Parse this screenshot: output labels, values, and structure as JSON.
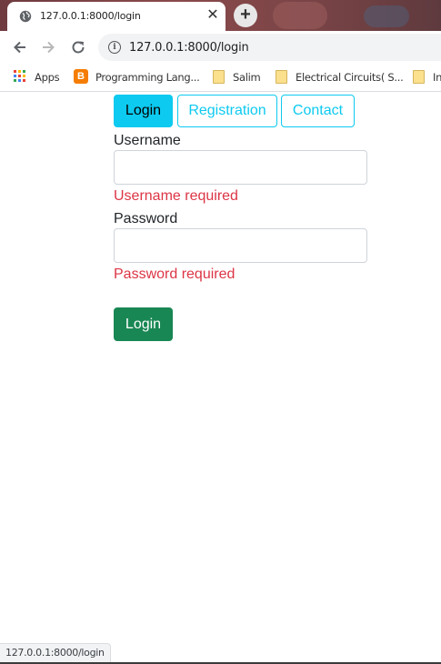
{
  "browser": {
    "tab": {
      "title": "127.0.0.1:8000/login",
      "icon": "globe-icon",
      "close_glyph": "✕"
    },
    "new_tab_glyph": "+",
    "address_bar": {
      "url": "127.0.0.1:8000/login",
      "icon": "info-icon"
    },
    "bookmarks": [
      {
        "label": "Apps",
        "icon": "apps-grid-icon"
      },
      {
        "label": "Programming Lang...",
        "icon": "blogger-icon"
      },
      {
        "label": "Salim",
        "icon": "folder-icon"
      },
      {
        "label": "Electrical Circuits( S...",
        "icon": "folder-icon"
      },
      {
        "label": "In",
        "icon": "folder-icon"
      }
    ],
    "status_url": "127.0.0.1:8000/login"
  },
  "nav": {
    "items": [
      {
        "label": "Login",
        "active": true
      },
      {
        "label": "Registration",
        "active": false
      },
      {
        "label": "Contact",
        "active": false
      }
    ]
  },
  "form": {
    "username": {
      "label": "Username",
      "value": "",
      "error": "Username required"
    },
    "password": {
      "label": "Password",
      "value": "",
      "error": "Password required"
    },
    "submit_label": "Login"
  },
  "colors": {
    "info": "#0dcaf0",
    "danger": "#dc3545",
    "success": "#198754",
    "text": "#212529"
  }
}
